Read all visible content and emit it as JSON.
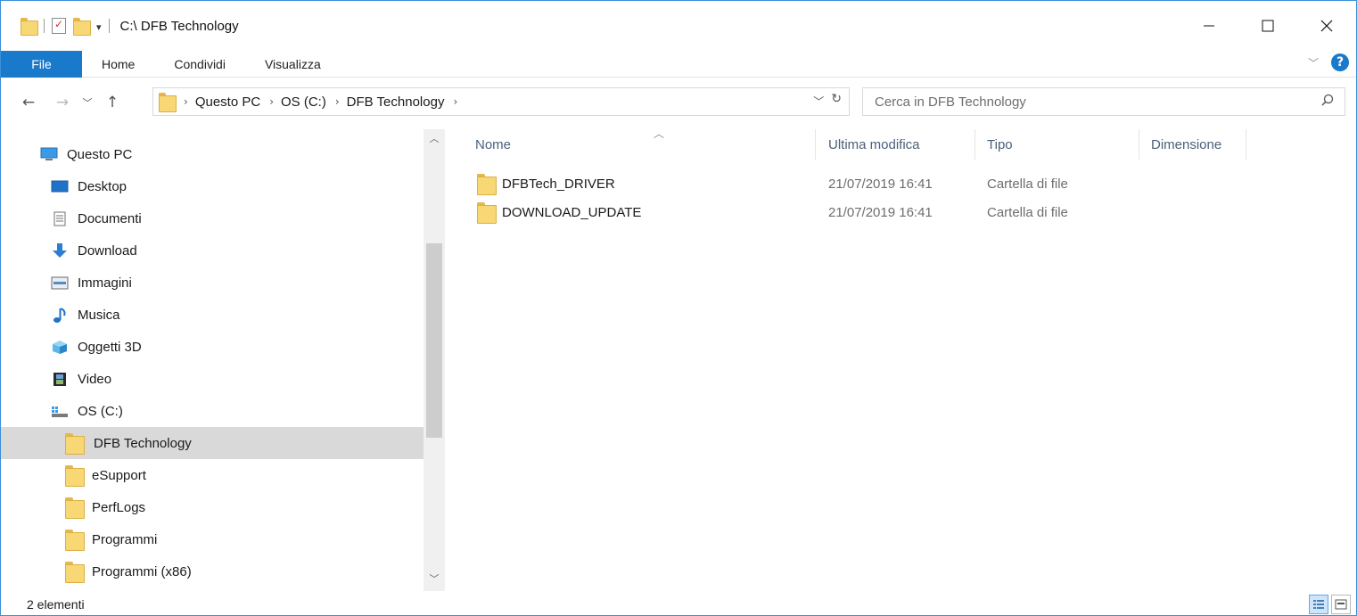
{
  "window": {
    "title": "C:\\ DFB Technology"
  },
  "ribbon": {
    "tabs": [
      {
        "label": "File",
        "active": true
      },
      {
        "label": "Home"
      },
      {
        "label": "Condividi"
      },
      {
        "label": "Visualizza"
      }
    ],
    "help": "?"
  },
  "address": {
    "crumbs": [
      "Questo PC",
      "OS (C:)",
      "DFB Technology"
    ]
  },
  "search": {
    "placeholder": "Cerca in  DFB Technology"
  },
  "nav": {
    "items": [
      {
        "label": "Questo PC",
        "icon": "monitor-icon"
      },
      {
        "label": "Desktop",
        "icon": "desktop-icon"
      },
      {
        "label": "Documenti",
        "icon": "document-icon"
      },
      {
        "label": "Download",
        "icon": "download-arrow-icon"
      },
      {
        "label": "Immagini",
        "icon": "image-icon"
      },
      {
        "label": "Musica",
        "icon": "music-note-icon"
      },
      {
        "label": "Oggetti 3D",
        "icon": "cube-3d-icon"
      },
      {
        "label": "Video",
        "icon": "film-icon"
      },
      {
        "label": "OS (C:)",
        "icon": "drive-icon"
      },
      {
        "label": "DFB Technology",
        "icon": "folder-icon",
        "selected": true
      },
      {
        "label": "eSupport",
        "icon": "folder-icon"
      },
      {
        "label": "PerfLogs",
        "icon": "folder-icon"
      },
      {
        "label": "Programmi",
        "icon": "folder-icon"
      },
      {
        "label": "Programmi (x86)",
        "icon": "folder-icon"
      }
    ]
  },
  "filelist": {
    "columns": [
      "Nome",
      "Ultima modifica",
      "Tipo",
      "Dimensione"
    ],
    "rows": [
      {
        "name": "DFBTech_DRIVER",
        "modified": "21/07/2019 16:41",
        "type": "Cartella di file",
        "size": ""
      },
      {
        "name": "DOWNLOAD_UPDATE",
        "modified": "21/07/2019 16:41",
        "type": "Cartella di file",
        "size": ""
      }
    ]
  },
  "status": {
    "count": "2 elementi"
  },
  "colors": {
    "accent": "#1979ca",
    "selection": "#d9d9d9",
    "folder": "#f8d775"
  }
}
